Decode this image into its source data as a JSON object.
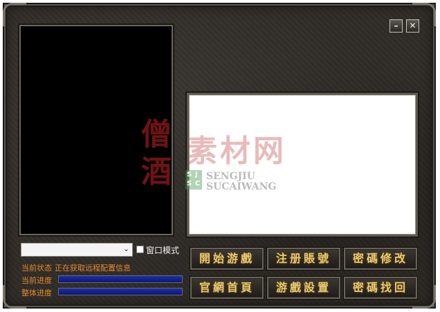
{
  "window": {
    "minimize_symbol": "–",
    "close_symbol": "✕"
  },
  "server_select": {
    "value": "",
    "arrow": "⌄"
  },
  "window_mode": {
    "label": "窗口模式",
    "checked": false
  },
  "status": {
    "label": "当前状态",
    "value": "正在获取远程配置信息"
  },
  "progress": {
    "current": {
      "label": "当前进度",
      "value_percent": 100
    },
    "overall": {
      "label": "整体进度",
      "value_percent": 100
    }
  },
  "buttons": {
    "start_game": "開始游戲",
    "register": "注册賬號",
    "change_password": "密碼修改",
    "homepage": "官網首頁",
    "settings": "游戲設置",
    "recover_password": "密碼找回"
  },
  "watermark": {
    "seal_top": "僧",
    "seal_bottom": "酒",
    "title": "素材网",
    "badge_tl": "S",
    "badge_tr": "J",
    "badge_bl": "S",
    "badge_br": "C",
    "line1": "SENGJIU",
    "line2": "SUCAIWANG"
  },
  "colors": {
    "status_text": "#e58a2a",
    "button_text": "#e8c977",
    "progress_fill": "#1b2fa6"
  }
}
